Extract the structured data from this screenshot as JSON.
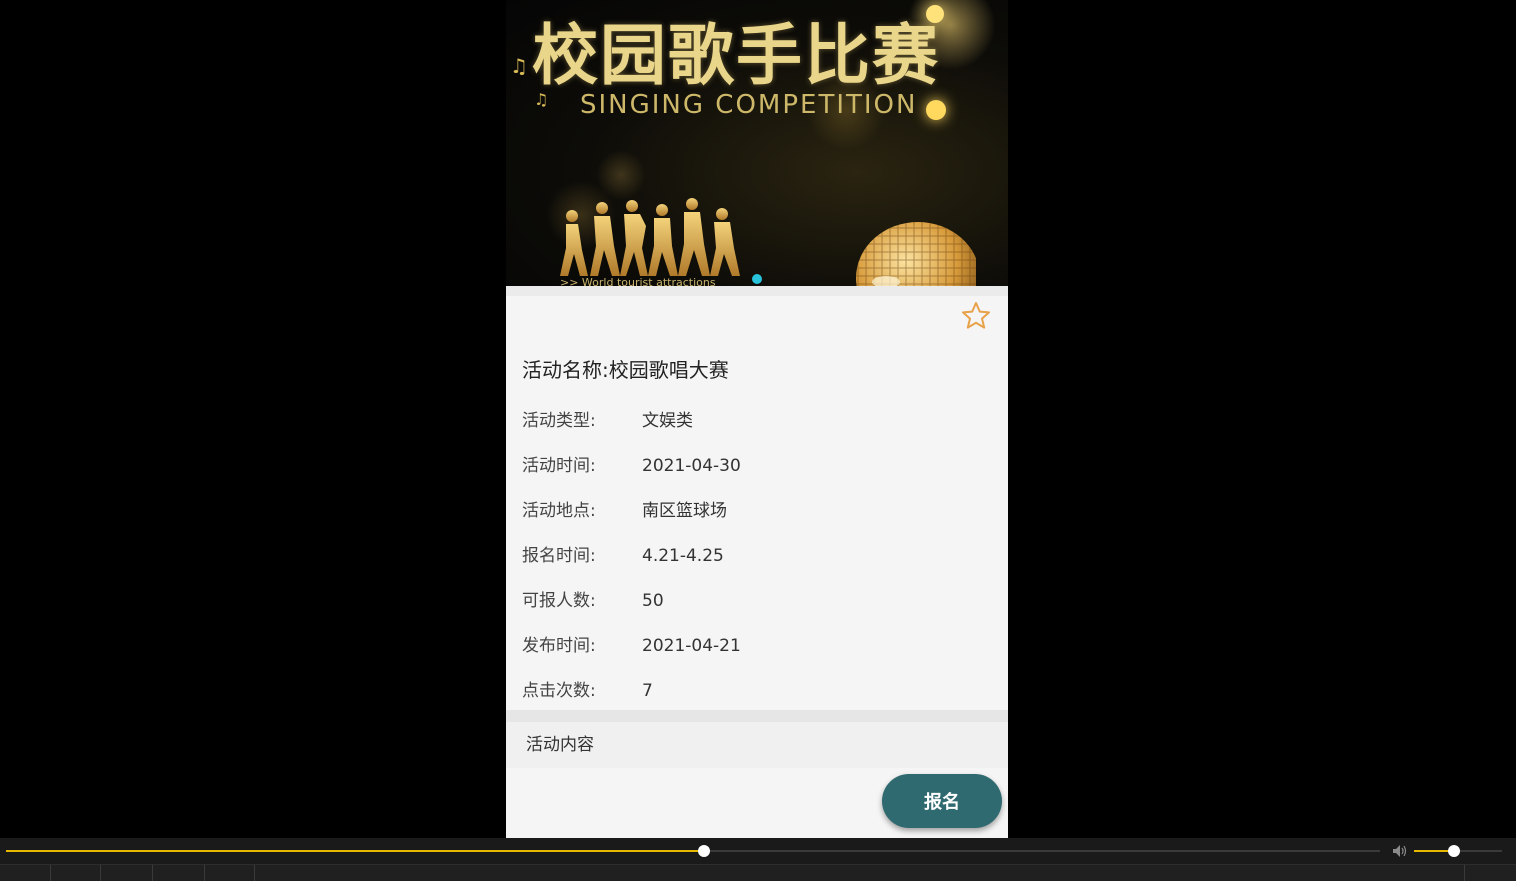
{
  "banner": {
    "title": "校园歌手比赛",
    "subtitle": "SINGING   COMPETITION",
    "caption": ">> World tourist attractions"
  },
  "activity": {
    "name_label": "活动名称:",
    "name_value": "校园歌唱大赛",
    "fields": [
      {
        "label": "活动类型:",
        "value": "文娱类"
      },
      {
        "label": "活动时间:",
        "value": "2021-04-30"
      },
      {
        "label": "活动地点:",
        "value": "南区篮球场"
      },
      {
        "label": "报名时间:",
        "value": "4.21-4.25"
      },
      {
        "label": "可报人数:",
        "value": "50"
      },
      {
        "label": "发布时间:",
        "value": "2021-04-21"
      },
      {
        "label": "点击次数:",
        "value": "7"
      }
    ],
    "content_heading": "活动内容"
  },
  "footer": {
    "signup_label": "报名"
  },
  "player": {
    "seek_progress": 0.508,
    "volume_level": 0.45
  },
  "icons": {
    "favorite": "star-outline-icon",
    "volume": "speaker-icon"
  },
  "colors": {
    "accent_teal": "#2f6a70",
    "star_orange": "#e8a24a",
    "carousel_dot": "#29c3dc",
    "progress_gold": "#e6b800"
  }
}
